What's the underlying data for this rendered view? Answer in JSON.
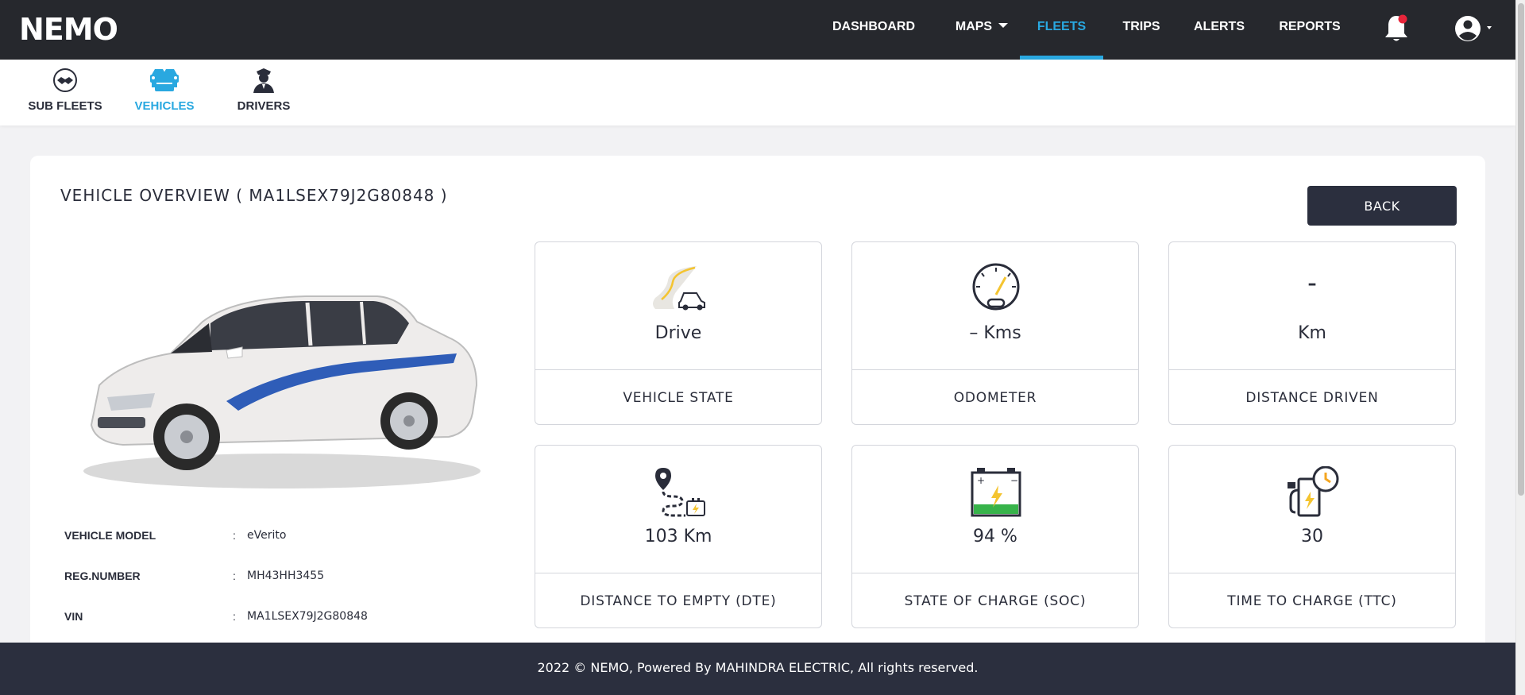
{
  "header": {
    "logo_text": "NEMO",
    "nav": [
      {
        "label": "DASHBOARD"
      },
      {
        "label": "MAPS"
      },
      {
        "label": "FLEETS"
      },
      {
        "label": "TRIPS"
      },
      {
        "label": "ALERTS"
      },
      {
        "label": "REPORTS"
      }
    ],
    "active_nav": "FLEETS",
    "notification_dot_color": "#e8253a",
    "icons": [
      "bell-icon",
      "user-account-icon",
      "chevron-down-icon"
    ]
  },
  "subnav": {
    "items": [
      {
        "label": "SUB FLEETS",
        "icon": "handshake-icon"
      },
      {
        "label": "VEHICLES",
        "icon": "vehicles-icon"
      },
      {
        "label": "DRIVERS",
        "icon": "driver-icon"
      }
    ],
    "active": "VEHICLES"
  },
  "overview": {
    "title": "VEHICLE OVERVIEW ( MA1LSEX79J2G80848 )",
    "back_label": "BACK",
    "specs": [
      {
        "label": "VEHICLE MODEL",
        "sep": ":",
        "value": "eVerito"
      },
      {
        "label": "REG.NUMBER",
        "sep": ":",
        "value": "MH43HH3455"
      },
      {
        "label": "VIN",
        "sep": ":",
        "value": "MA1LSEX79J2G80848"
      }
    ]
  },
  "metrics": [
    {
      "value": "Drive",
      "label": "VEHICLE STATE",
      "icon": "road-car-icon"
    },
    {
      "value": "– Kms",
      "label": "ODOMETER",
      "icon": "speedometer-icon"
    },
    {
      "value": "–",
      "value2": "Km",
      "label": "DISTANCE DRIVEN",
      "icon": ""
    },
    {
      "value": "103 Km",
      "label": "DISTANCE TO EMPTY (DTE)",
      "icon": "route-pin-icon"
    },
    {
      "value": "94 %",
      "label": "STATE OF CHARGE (SOC)",
      "icon": "battery-icon"
    },
    {
      "value": "30",
      "label": "TIME TO CHARGE (TTC)",
      "icon": "charging-station-clock-icon"
    }
  ],
  "footer": {
    "text": "2022 © NEMO, Powered By MAHINDRA ELECTRIC, All rights reserved."
  },
  "colors": {
    "nav_bg": "#26282d",
    "accent": "#29a8e0",
    "button_bg": "#2b2f3e",
    "footer_bg": "#2b2f3e",
    "page_bg": "#f2f2f4",
    "car_stripe": "#2f5db8",
    "battery_green": "#37b34a",
    "gauge_yellow": "#f4c430"
  }
}
